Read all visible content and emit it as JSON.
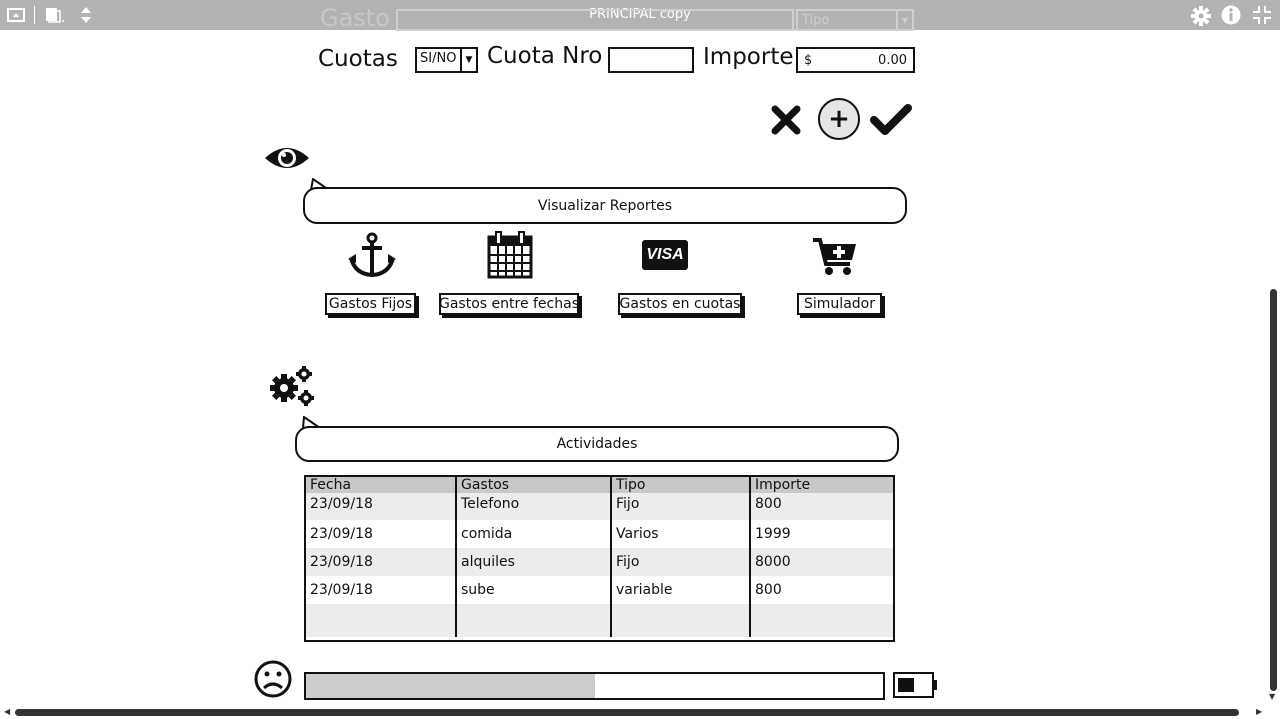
{
  "window": {
    "title": "PRINCIPAL copy",
    "toolbar_icons": [
      "window-icon",
      "copy-pages-icon",
      "expand-icon",
      "gear-icon",
      "info-icon",
      "fullscreen-exit-icon"
    ]
  },
  "form": {
    "gasto_label": "Gasto",
    "tipo_placeholder": "Tipo",
    "cuotas_label": "Cuotas",
    "cuotas_select": "SI/NO",
    "cuota_nro_label": "Cuota Nro",
    "cuota_nro_value": "",
    "importe_label": "Importe",
    "importe_currency": "$",
    "importe_value": "0.00"
  },
  "actions": {
    "cancel_icon": "x-icon",
    "add_symbol": "+",
    "confirm_icon": "checkmark-icon"
  },
  "reports": {
    "icon": "eye-icon",
    "title": "Visualizar Reportes",
    "buttons": [
      {
        "label": "Gastos Fijos",
        "icon": "anchor-icon"
      },
      {
        "label": "Gastos entre fechas",
        "icon": "calendar-icon"
      },
      {
        "label": "Gastos en cuotas",
        "icon": "visa-card-icon",
        "icon_text": "VISA"
      },
      {
        "label": "Simulador",
        "icon": "cart-plus-icon"
      }
    ]
  },
  "activities": {
    "icon": "gears-icon",
    "title": "Actividades",
    "columns": [
      "Fecha",
      "Gastos",
      "Tipo",
      "Importe"
    ],
    "rows": [
      [
        "23/09/18",
        "Telefono",
        "Fijo",
        "800"
      ],
      [
        "23/09/18",
        "comida",
        "Varios",
        "1999"
      ],
      [
        "23/09/18",
        "alquiles",
        "Fijo",
        "8000"
      ],
      [
        "23/09/18",
        "sube",
        "variable",
        "800"
      ],
      [
        "",
        "",
        "",
        ""
      ]
    ]
  },
  "status": {
    "mood_icon": "sad-face-icon",
    "progress_fraction": 0.5,
    "battery_icon": "battery-icon",
    "battery_level": 0.5
  },
  "colors": {
    "toolbar": "#b3b3b3",
    "ink": "#111111",
    "header_row": "#c8c8c8",
    "alt_row": "#ececec",
    "progress_fill": "#cccccc"
  }
}
